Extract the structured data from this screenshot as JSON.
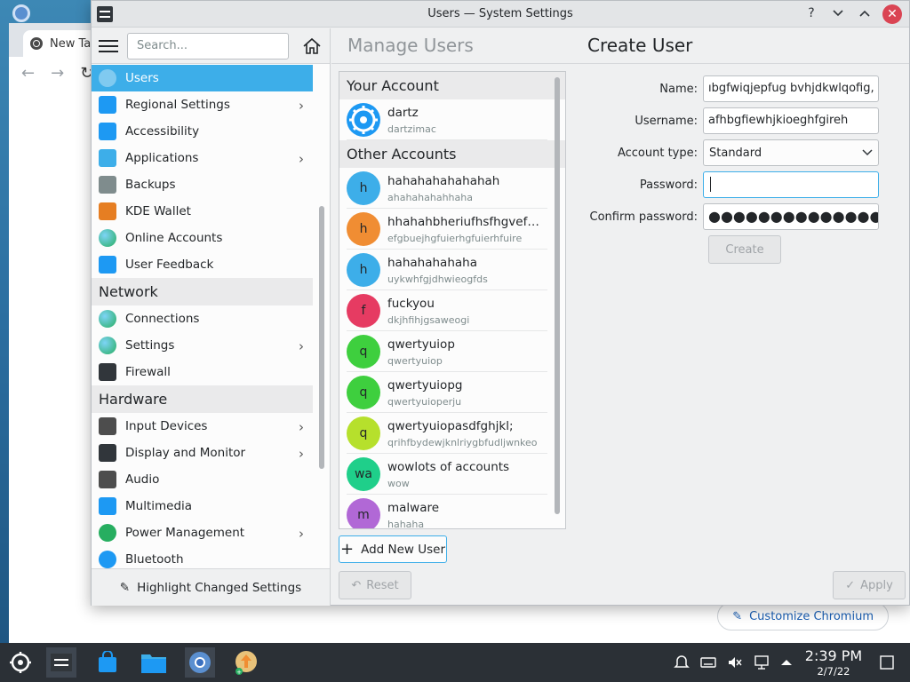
{
  "window": {
    "title": "Users — System Settings",
    "controls": {
      "help": "?",
      "minimize": "⌄",
      "maximize": "⌃",
      "close": "✕"
    }
  },
  "background_browser": {
    "tab_label": "New Tab",
    "customize_label": "Customize Chromium"
  },
  "sidebar": {
    "search_placeholder": "Search...",
    "items": [
      {
        "label": "Users",
        "icon": "users-icon",
        "active": true,
        "chevron": false
      },
      {
        "label": "Regional Settings",
        "icon": "regional-settings-icon",
        "chevron": true
      },
      {
        "label": "Accessibility",
        "icon": "accessibility-icon",
        "chevron": false
      },
      {
        "label": "Applications",
        "icon": "applications-icon",
        "chevron": true
      },
      {
        "label": "Backups",
        "icon": "backups-icon",
        "chevron": false
      },
      {
        "label": "KDE Wallet",
        "icon": "wallet-icon",
        "chevron": false
      },
      {
        "label": "Online Accounts",
        "icon": "online-accounts-icon",
        "chevron": false
      },
      {
        "label": "User Feedback",
        "icon": "user-feedback-icon",
        "chevron": false
      }
    ],
    "network_title": "Network",
    "network_items": [
      {
        "label": "Connections",
        "icon": "connections-icon",
        "chevron": false
      },
      {
        "label": "Settings",
        "icon": "network-settings-icon",
        "chevron": true
      },
      {
        "label": "Firewall",
        "icon": "firewall-icon",
        "chevron": false
      }
    ],
    "hardware_title": "Hardware",
    "hardware_items": [
      {
        "label": "Input Devices",
        "icon": "input-devices-icon",
        "chevron": true
      },
      {
        "label": "Display and Monitor",
        "icon": "display-icon",
        "chevron": true
      },
      {
        "label": "Audio",
        "icon": "audio-icon",
        "chevron": false
      },
      {
        "label": "Multimedia",
        "icon": "multimedia-icon",
        "chevron": false
      },
      {
        "label": "Power Management",
        "icon": "power-icon",
        "chevron": true
      },
      {
        "label": "Bluetooth",
        "icon": "bluetooth-icon",
        "chevron": false
      }
    ],
    "footer_label": "Highlight Changed Settings"
  },
  "main": {
    "breadcrumb_manage": "Manage Users",
    "breadcrumb_create": "Create User",
    "your_account_title": "Your Account",
    "your_account": {
      "name": "dartz",
      "login": "dartzimac"
    },
    "other_accounts_title": "Other Accounts",
    "other_accounts": [
      {
        "initial": "h",
        "name": "hahahahahahahah",
        "login": "ahahahahahhaha",
        "color": "#3daee9"
      },
      {
        "initial": "h",
        "name": "hhahahbheriufhsfhgvefsg...",
        "login": "efgbuejhgfuierhgfuierhfuire",
        "color": "#f08d33"
      },
      {
        "initial": "h",
        "name": "hahahahahaha",
        "login": "uykwhfgjdhwieogfds",
        "color": "#3daee9"
      },
      {
        "initial": "f",
        "name": "fuckyou",
        "login": "dkjhfihjgsaweogi",
        "color": "#e63b62"
      },
      {
        "initial": "q",
        "name": "qwertyuiop",
        "login": "qwertyuiop",
        "color": "#3ecf3e"
      },
      {
        "initial": "q",
        "name": "qwertyuiopg",
        "login": "qwertyuioperju",
        "color": "#3ecf3e"
      },
      {
        "initial": "q",
        "name": "qwertyuiopasdfghjkl;",
        "login": "qrihfbydewjknlriygbfudljwnkeo",
        "color": "#b6e02c"
      },
      {
        "initial": "wa",
        "name": "wowlots of accounts",
        "login": "wow",
        "color": "#1fcf8a"
      },
      {
        "initial": "m",
        "name": "malware",
        "login": "hahaha",
        "color": "#b168d6"
      }
    ],
    "add_user_label": "Add New User",
    "reset_label": "Reset",
    "apply_label": "Apply"
  },
  "form": {
    "name_label": "Name:",
    "name_value": "ıbgfwiqjepfug bvhjdkwlqofig, b",
    "username_label": "Username:",
    "username_value": "afhbgfiewhjkioeghfgireh",
    "account_type_label": "Account type:",
    "account_type_value": "Standard",
    "password_label": "Password:",
    "password_value": "",
    "confirm_label": "Confirm password:",
    "confirm_value": "●●●●●●●●●●●●●●",
    "create_label": "Create"
  },
  "taskbar": {
    "time": "2:39 PM",
    "date": "2/7/22"
  },
  "colors": {
    "accent": "#3daee9",
    "window_bg": "#eff0f1",
    "taskbar_bg": "#2b3036"
  }
}
